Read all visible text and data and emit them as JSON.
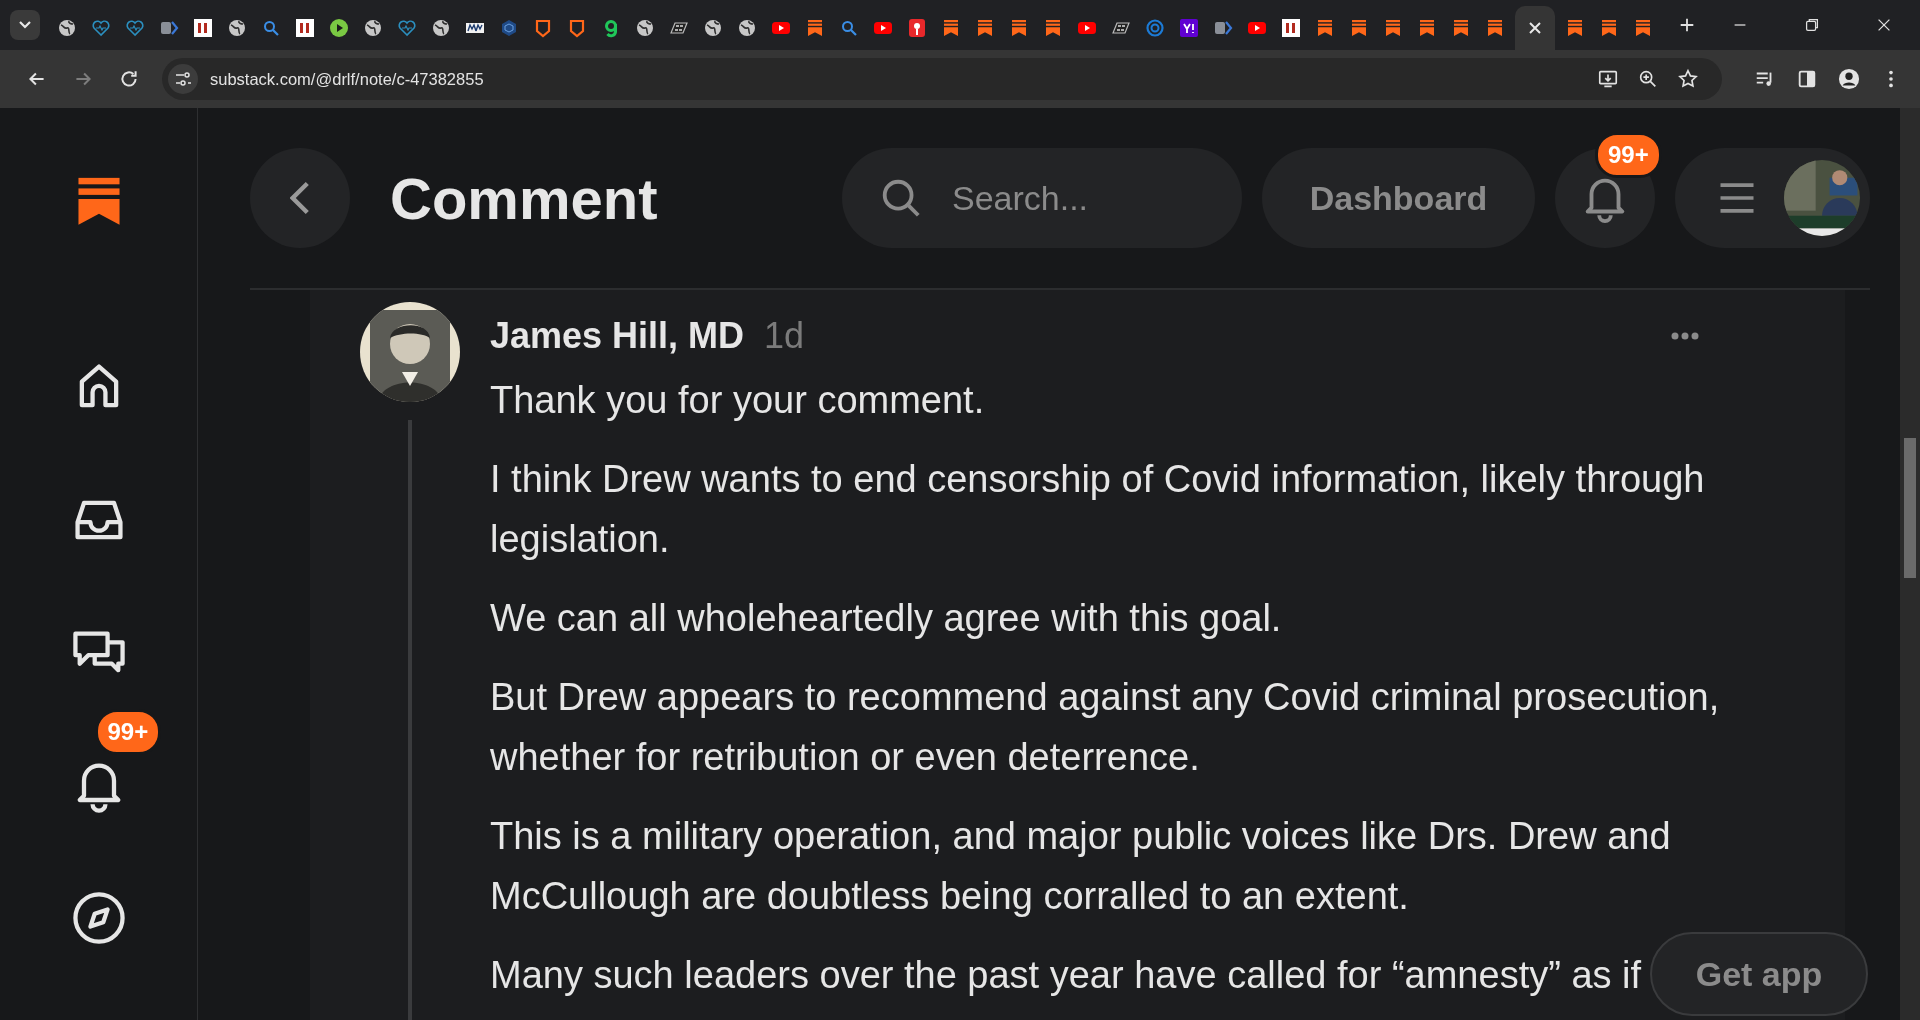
{
  "browser": {
    "tabs": [
      {
        "kind": "globe",
        "selected": false
      },
      {
        "kind": "heart",
        "selected": false
      },
      {
        "kind": "heart",
        "selected": false
      },
      {
        "kind": "arrow",
        "selected": false
      },
      {
        "kind": "bi",
        "selected": false
      },
      {
        "kind": "globe",
        "selected": false
      },
      {
        "kind": "search",
        "selected": false
      },
      {
        "kind": "bi",
        "selected": false
      },
      {
        "kind": "play",
        "selected": false
      },
      {
        "kind": "globe",
        "selected": false
      },
      {
        "kind": "heart",
        "selected": false
      },
      {
        "kind": "globe",
        "selected": false
      },
      {
        "kind": "mw",
        "selected": false
      },
      {
        "kind": "cube",
        "selected": false
      },
      {
        "kind": "shield",
        "selected": false
      },
      {
        "kind": "shield",
        "selected": false
      },
      {
        "kind": "g",
        "selected": false
      },
      {
        "kind": "globe",
        "selected": false
      },
      {
        "kind": "dr",
        "selected": false
      },
      {
        "kind": "globe",
        "selected": false
      },
      {
        "kind": "globe",
        "selected": false
      },
      {
        "kind": "youtube",
        "selected": false
      },
      {
        "kind": "substack",
        "selected": false
      },
      {
        "kind": "search",
        "selected": false
      },
      {
        "kind": "youtube",
        "selected": false
      },
      {
        "kind": "pin",
        "selected": false
      },
      {
        "kind": "substack",
        "selected": false
      },
      {
        "kind": "substack",
        "selected": false
      },
      {
        "kind": "substack",
        "selected": false
      },
      {
        "kind": "substack",
        "selected": false
      },
      {
        "kind": "youtube",
        "selected": false
      },
      {
        "kind": "dr",
        "selected": false
      },
      {
        "kind": "c",
        "selected": false
      },
      {
        "kind": "yahoo",
        "selected": false
      },
      {
        "kind": "arrow",
        "selected": false
      },
      {
        "kind": "youtube",
        "selected": false
      },
      {
        "kind": "bi",
        "selected": false
      },
      {
        "kind": "substack",
        "selected": false
      },
      {
        "kind": "substack",
        "selected": false
      },
      {
        "kind": "substack",
        "selected": false
      },
      {
        "kind": "substack",
        "selected": false
      },
      {
        "kind": "substack",
        "selected": false
      },
      {
        "kind": "substack",
        "selected": false
      },
      {
        "selected": true
      },
      {
        "kind": "substack",
        "selected": false
      },
      {
        "kind": "substack",
        "selected": false
      },
      {
        "kind": "substack",
        "selected": false
      }
    ],
    "address": "substack.com/@drlf/note/c-47382855"
  },
  "sidebar": {
    "items": [
      {
        "kind": "home"
      },
      {
        "kind": "inbox"
      },
      {
        "kind": "chat"
      },
      {
        "kind": "bell",
        "badge": "99+"
      },
      {
        "kind": "explore"
      }
    ]
  },
  "header": {
    "title": "Comment",
    "search": {
      "placeholder": "Search..."
    },
    "dashboard": "Dashboard",
    "notifications_badge": "99+"
  },
  "comment": {
    "author": "James Hill, MD",
    "time": "1d",
    "paragraphs": [
      "Thank you for your comment.",
      "I think Drew wants to end censorship of Covid information, likely through legislation.",
      "We can all wholeheartedly agree with this goal.",
      "But Drew appears to recommend against any Covid criminal prosecution, whether for retribution or even deterrence.",
      "This is a military operation, and major public voices like Drs. Drew and McCullough are doubtless being corralled to an extent.",
      "Many such leaders over the past year have called for “amnesty” as if"
    ]
  },
  "get_app": "Get app"
}
